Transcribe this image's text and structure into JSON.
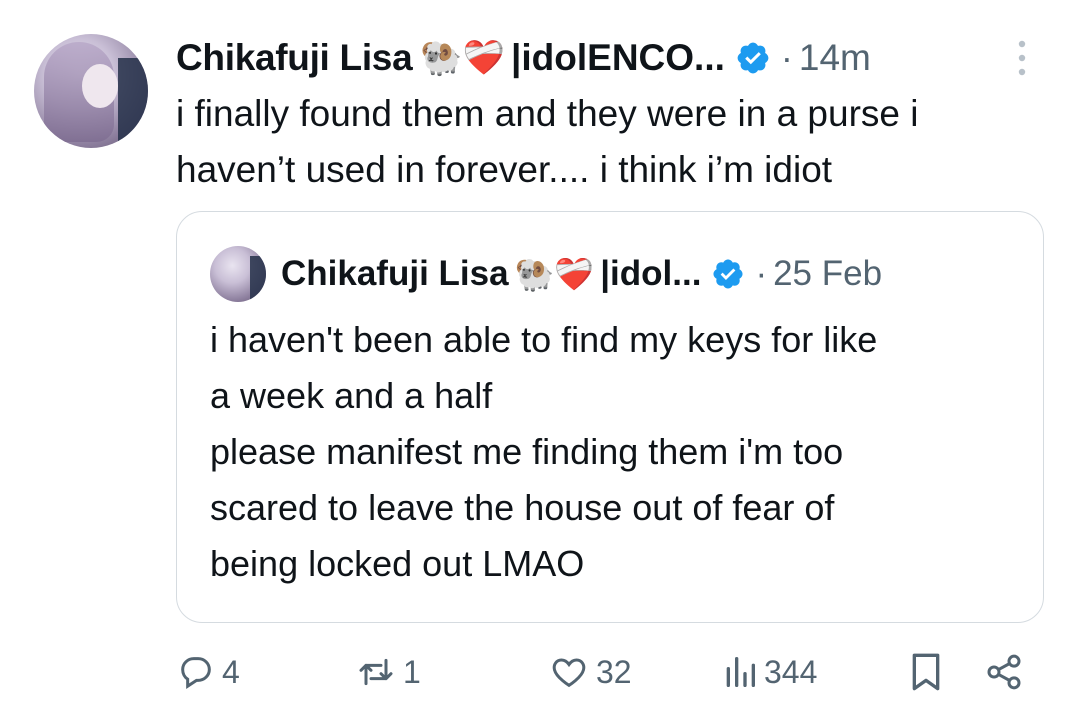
{
  "tweet": {
    "author_name": "Chikafuji Lisa",
    "emoji": "🐏❤️‍🩹",
    "separator": "|",
    "handle_truncated": "idolENCO...",
    "dot": "·",
    "time": "14m",
    "text_lines": [
      "i finally found them and they were in a purse i",
      "haven’t used in forever.... i think i’m idiot"
    ]
  },
  "quote": {
    "author_name": "Chikafuji Lisa",
    "emoji": "🐏❤️‍🩹",
    "separator": "|",
    "handle_truncated": "idol...",
    "dot": "·",
    "time": "25 Feb",
    "text_lines": [
      "i haven't been able to find my keys for like",
      "a week and a half",
      "please manifest me finding them i'm too",
      "scared to leave the house out of fear of",
      "being locked out LMAO"
    ]
  },
  "actions": {
    "replies": "4",
    "reposts": "1",
    "likes": "32",
    "views": "344"
  },
  "colors": {
    "verified_blue": "#1d9bf0",
    "secondary_text": "#536471",
    "border": "#d5dbe0"
  },
  "icons": [
    "more-icon",
    "verified-icon",
    "reply-icon",
    "repost-icon",
    "like-icon",
    "views-icon",
    "bookmark-icon",
    "share-icon"
  ]
}
